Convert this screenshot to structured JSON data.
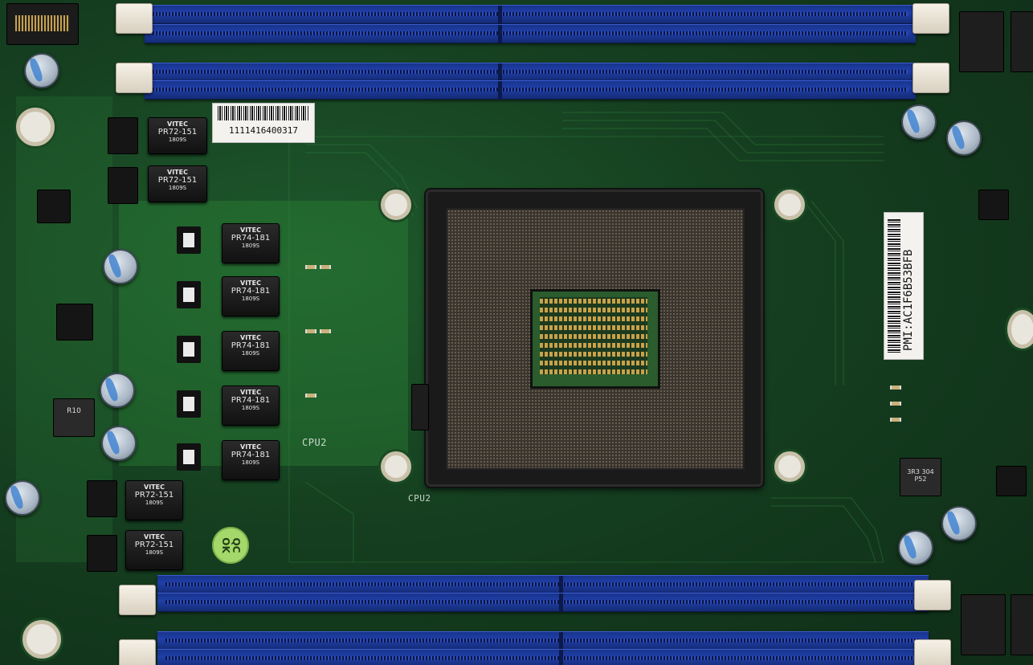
{
  "inductors_left": [
    {
      "brand": "VITEC",
      "model": "PR72-151",
      "date": "1809S"
    },
    {
      "brand": "VITEC",
      "model": "PR72-151",
      "date": "1809S"
    },
    {
      "brand": "VITEC",
      "model": "PR74-181",
      "date": "1809S"
    },
    {
      "brand": "VITEC",
      "model": "PR74-181",
      "date": "1809S"
    },
    {
      "brand": "VITEC",
      "model": "PR74-181",
      "date": "1809S"
    },
    {
      "brand": "VITEC",
      "model": "PR74-181",
      "date": "1809S"
    },
    {
      "brand": "VITEC",
      "model": "PR74-181",
      "date": "1809S"
    },
    {
      "brand": "VITEC",
      "model": "PR72-151",
      "date": "1809S"
    },
    {
      "brand": "VITEC",
      "model": "PR72-151",
      "date": "1809S"
    }
  ],
  "labels": {
    "barcode_number": "1111416400317",
    "pmi_label": "PMI:AC1F6B53BFB",
    "qc_stamp": "QC OK",
    "socket_silk": "CPU2",
    "socket_silk2": "CPU2",
    "inductor_small_r10": "R10",
    "inductor_small_r10b": "3R3 304 P52"
  },
  "colors": {
    "pcb": "#1f5a2c",
    "dimm_blue": "#203fa8",
    "latch": "#f2ede2",
    "qc_sticker": "#a4d86a"
  }
}
